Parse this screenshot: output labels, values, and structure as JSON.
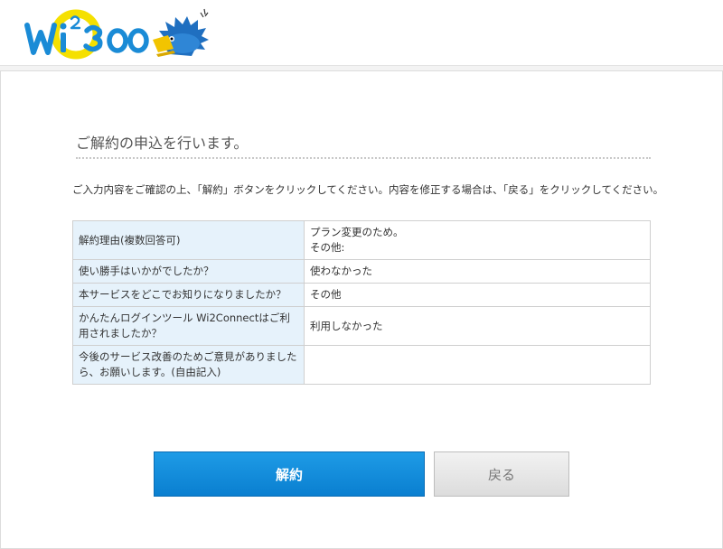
{
  "header": {
    "logo_text": "Wi2 300"
  },
  "page": {
    "title": "ご解約の申込を行います。",
    "description": "ご入力内容をご確認の上、「解約」ボタンをクリックしてください。内容を修正する場合は、「戻る」をクリックしてください。"
  },
  "confirm_table": {
    "rows": [
      {
        "label": "解約理由(複数回答可)",
        "value_line1": "プラン変更のため。",
        "value_line2": "その他:"
      },
      {
        "label": "使い勝手はいかがでしたか？",
        "value": "使わなかった"
      },
      {
        "label": "本サービスをどこでお知りになりましたか？",
        "value": "その他"
      },
      {
        "label": "かんたんログインツール Wi2Connectはご利用されましたか？",
        "value": "利用しなかった"
      },
      {
        "label": "今後のサービス改善のためご意見がありましたら、お願いします。(自由記入)",
        "value": ""
      }
    ]
  },
  "buttons": {
    "cancel_contract": "解約",
    "back": "戻る"
  },
  "colors": {
    "accent_blue": "#0a7fd0",
    "logo_yellow": "#f5e000",
    "table_header_bg": "#e6f2fb"
  }
}
